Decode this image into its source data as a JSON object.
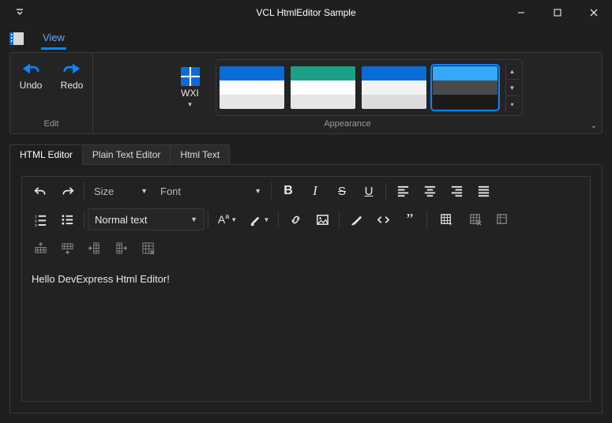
{
  "window": {
    "title": "VCL HtmlEditor Sample"
  },
  "ribbon": {
    "active_tab": "View",
    "tabs": [
      "View"
    ],
    "edit_group": {
      "undo_label": "Undo",
      "redo_label": "Redo",
      "caption": "Edit"
    },
    "appearance_group": {
      "caption": "Appearance",
      "skin_label": "WXI",
      "themes": [
        {
          "name": "wxi-light",
          "c1": "#0a6cd6",
          "c2": "#ffffff",
          "c3": "#e6e6e6",
          "selected": false
        },
        {
          "name": "green",
          "c1": "#1aa187",
          "c2": "#ffffff",
          "c3": "#e6e6e6",
          "selected": false
        },
        {
          "name": "blue-gray",
          "c1": "#0a6cd6",
          "c2": "#f2f2f2",
          "c3": "#dcdcdc",
          "selected": false
        },
        {
          "name": "dark",
          "c1": "#33aaff",
          "c2": "#4a4a4a",
          "c3": "#1b1b1b",
          "selected": true
        }
      ]
    }
  },
  "doc_tabs": {
    "items": [
      {
        "label": "HTML Editor",
        "active": true
      },
      {
        "label": "Plain Text Editor",
        "active": false
      },
      {
        "label": "Html Text",
        "active": false
      }
    ]
  },
  "editor": {
    "size_placeholder": "Size",
    "font_placeholder": "Font",
    "para_label": "Normal text",
    "content": "Hello DevExpress Html Editor!"
  },
  "icons": {
    "undo": "undo-arrow",
    "redo": "redo-arrow"
  },
  "colors": {
    "accent": "#0a84ff",
    "link": "#5fa8ff",
    "bg": "#1f1f1f",
    "panel": "#242424"
  }
}
